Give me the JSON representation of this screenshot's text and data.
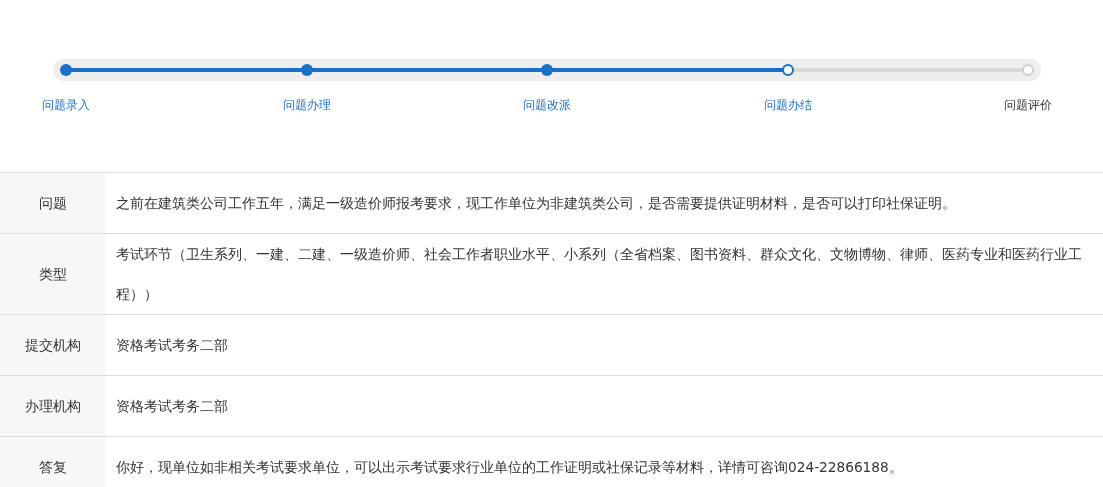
{
  "progress": {
    "level": 0.75,
    "steps": [
      {
        "label": "问题录入",
        "completed": true,
        "current": false
      },
      {
        "label": "问题办理",
        "completed": true,
        "current": false
      },
      {
        "label": "问题改派",
        "completed": true,
        "current": false
      },
      {
        "label": "问题办结",
        "completed": false,
        "current": true
      },
      {
        "label": "问题评价",
        "completed": false,
        "current": false
      }
    ]
  },
  "details": [
    {
      "label": "问题",
      "value": "之前在建筑类公司工作五年，满足一级造价师报考要求，现工作单位为非建筑类公司，是否需要提供证明材料，是否可以打印社保证明。"
    },
    {
      "label": "类型",
      "value": "考试环节（卫生系列、一建、二建、一级造价师、社会工作者职业水平、小系列（全省档案、图书资料、群众文化、文物博物、律师、医药专业和医药行业工程））"
    },
    {
      "label": "提交机构",
      "value": "资格考试考务二部"
    },
    {
      "label": "办理机构",
      "value": "资格考试考务二部"
    },
    {
      "label": "答复",
      "value": "你好，现单位如非相关考试要求单位，可以出示考试要求行业单位的工作证明或社保记录等材料，详情可咨询024-22866188。"
    }
  ]
}
